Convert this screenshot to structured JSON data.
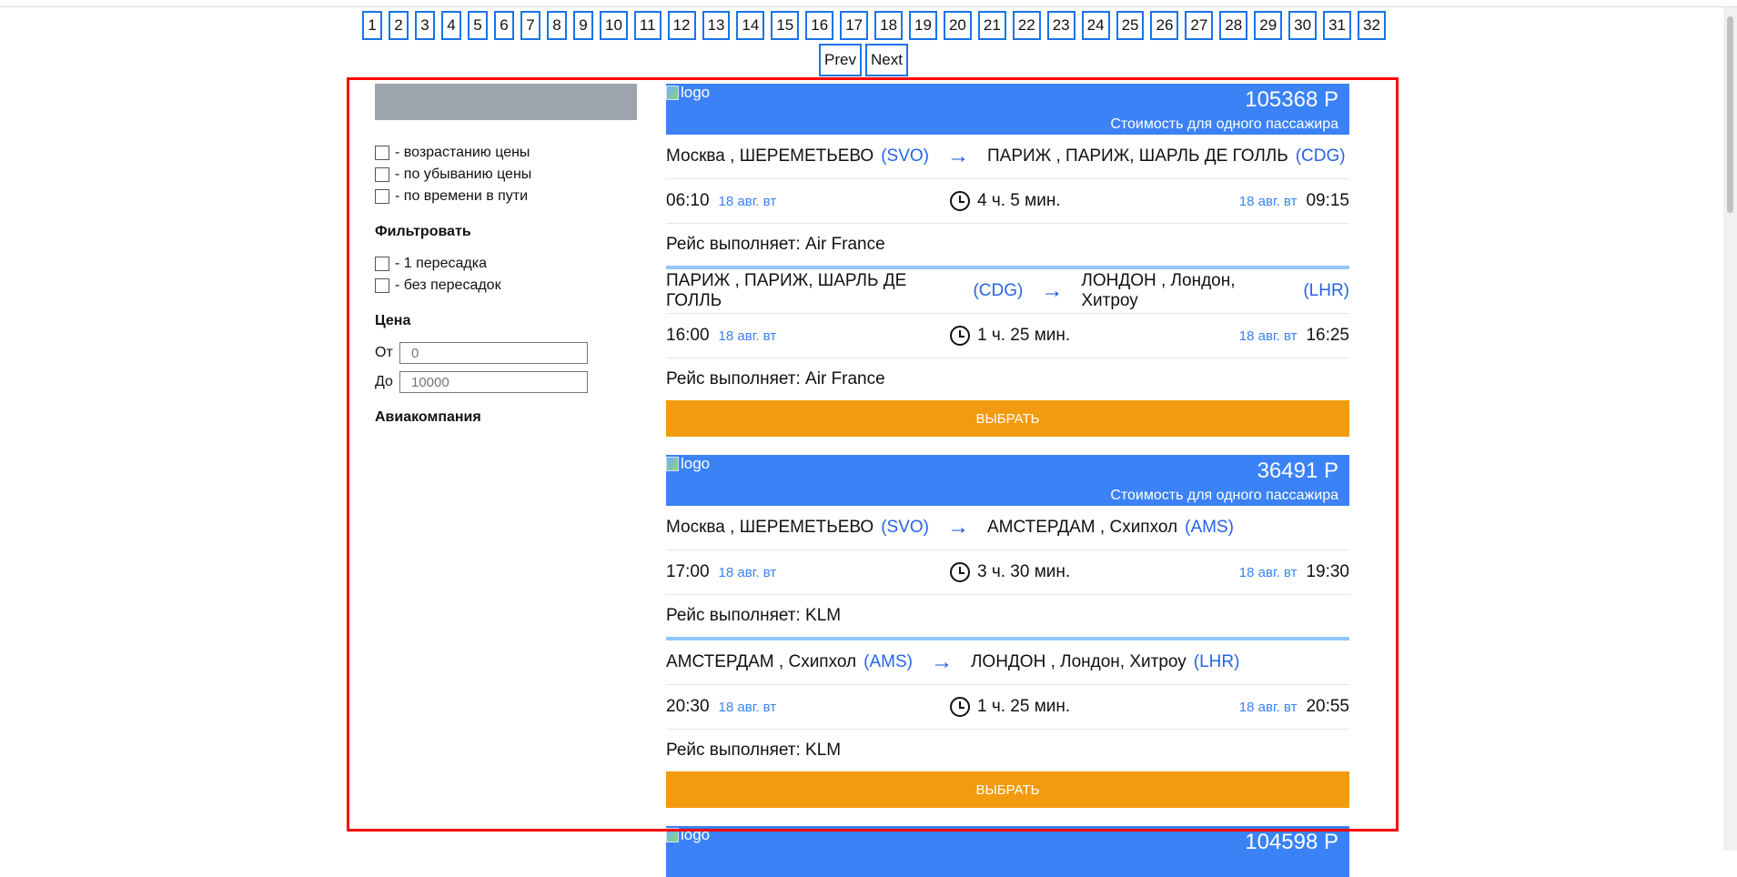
{
  "pagination": {
    "pages": [
      "1",
      "2",
      "3",
      "4",
      "5",
      "6",
      "7",
      "8",
      "9",
      "10",
      "11",
      "12",
      "13",
      "14",
      "15",
      "16",
      "17",
      "18",
      "19",
      "20",
      "21",
      "22",
      "23",
      "24",
      "25",
      "26",
      "27",
      "28",
      "29",
      "30",
      "31",
      "32"
    ],
    "prev_label": "Prev",
    "next_label": "Next"
  },
  "sidebar": {
    "sort_options": [
      "- возрастанию цены",
      "- по убыванию цены",
      "- по времени в пути"
    ],
    "filter_heading": "Фильтровать",
    "filter_options": [
      "- 1 пересадка",
      "- без пересадок"
    ],
    "price_heading": "Цена",
    "price_from_label": "От",
    "price_from_placeholder": "0",
    "price_to_label": "До",
    "price_to_placeholder": "10000",
    "airline_heading": "Авиакомпания"
  },
  "results": [
    {
      "logo_alt": "logo",
      "price": "105368 Р",
      "price_note": "Стоимость для одного пассажира",
      "select_label": "выбрать",
      "segments": [
        {
          "from": "Москва , ШЕРЕМЕТЬЕВО",
          "from_code": "(SVO)",
          "to": "ПАРИЖ , ПАРИЖ, ШАРЛЬ ДЕ ГОЛЛЬ",
          "to_code": "(CDG)",
          "dep_time": "06:10",
          "dep_date": "18 авг. вт",
          "duration": "4 ч. 5 мин.",
          "arr_date": "18 авг. вт",
          "arr_time": "09:15",
          "carrier": "Рейс выполняет: Air France"
        },
        {
          "from": "ПАРИЖ , ПАРИЖ, ШАРЛЬ ДЕ ГОЛЛЬ",
          "from_code": "(CDG)",
          "to": "ЛОНДОН , Лондон, Хитроу",
          "to_code": "(LHR)",
          "dep_time": "16:00",
          "dep_date": "18 авг. вт",
          "duration": "1 ч. 25 мин.",
          "arr_date": "18 авг. вт",
          "arr_time": "16:25",
          "carrier": "Рейс выполняет: Air France"
        }
      ]
    },
    {
      "logo_alt": "logo",
      "price": "36491 Р",
      "price_note": "Стоимость для одного пассажира",
      "select_label": "выбрать",
      "segments": [
        {
          "from": "Москва , ШЕРЕМЕТЬЕВО",
          "from_code": "(SVO)",
          "to": "АМСТЕРДАМ , Схипхол",
          "to_code": "(AMS)",
          "dep_time": "17:00",
          "dep_date": "18 авг. вт",
          "duration": "3 ч. 30 мин.",
          "arr_date": "18 авг. вт",
          "arr_time": "19:30",
          "carrier": "Рейс выполняет: KLM"
        },
        {
          "from": "АМСТЕРДАМ , Схипхол",
          "from_code": "(AMS)",
          "to": "ЛОНДОН , Лондон, Хитроу",
          "to_code": "(LHR)",
          "dep_time": "20:30",
          "dep_date": "18 авг. вт",
          "duration": "1 ч. 25 мин.",
          "arr_date": "18 авг. вт",
          "arr_time": "20:55",
          "carrier": "Рейс выполняет: KLM"
        }
      ]
    },
    {
      "logo_alt": "logo",
      "price": "104598 Р"
    }
  ],
  "colors": {
    "card_header": "#3b82f6",
    "select_button": "#f29b0e",
    "highlight_frame": "#ff0000",
    "page_button_border": "#1a73e8"
  }
}
